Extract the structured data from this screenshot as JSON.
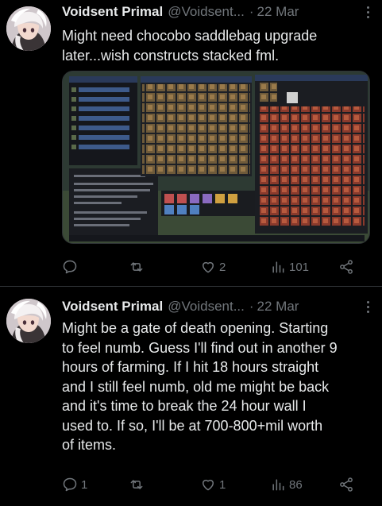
{
  "colors": {
    "background": "#000000",
    "text": "#e7e9ea",
    "muted": "#71767b",
    "divider": "#2f3336"
  },
  "tweets": [
    {
      "author": {
        "name": "Voidsent Primal",
        "handle": "@Voidsent...",
        "avatar_icon": "avatar-icon"
      },
      "separator": "·",
      "date": "22 Mar",
      "lines": [
        "Might need chocobo saddlebag upgrade",
        "later...wish constructs stacked fml."
      ],
      "media": {
        "description_icon": "game-inventory-screenshot"
      },
      "actions": {
        "replies": "",
        "reposts": "",
        "likes": "2",
        "views": "101"
      }
    },
    {
      "author": {
        "name": "Voidsent Primal",
        "handle": "@Voidsent...",
        "avatar_icon": "avatar-icon"
      },
      "separator": "·",
      "date": "22 Mar",
      "lines": [
        "Might be a gate of death opening. Starting",
        "to feel numb. Guess I'll find out in another 9",
        "hours of farming. If I hit 18 hours straight",
        "and I still feel numb, old me might be back",
        "and it's time to break the 24 hour wall I",
        "used to. If so, I'll be at 700-800+mil worth",
        "of items."
      ],
      "actions": {
        "replies": "1",
        "reposts": "",
        "likes": "1",
        "views": "86"
      }
    }
  ]
}
